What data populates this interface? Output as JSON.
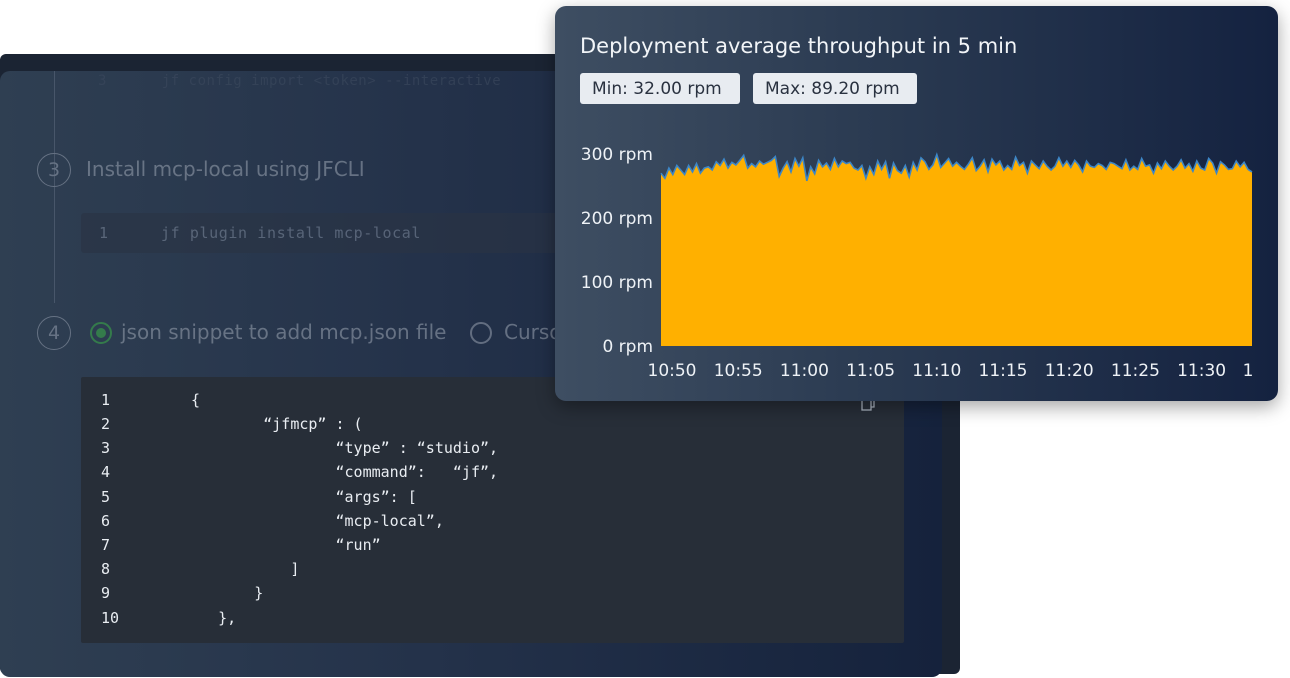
{
  "background_steps": {
    "faint_top_line": {
      "number": "3",
      "code": "jf config import <token> --interactive"
    },
    "step3": {
      "number": "3",
      "title": "Install mcp-local using JFCLI"
    },
    "step3_code": {
      "line_number": "1",
      "code": "jf plugin install mcp-local"
    },
    "step4": {
      "number": "4"
    },
    "options": [
      {
        "label": "json snippet to add mcp.json file",
        "selected": true
      },
      {
        "label": "Cursor",
        "selected": false
      }
    ],
    "code_block": {
      "lines": [
        {
          "n": "1",
          "text": "{"
        },
        {
          "n": "2",
          "text": "        “jfmcp” : ("
        },
        {
          "n": "3",
          "text": "                “type” : “studio”,"
        },
        {
          "n": "4",
          "text": "                “command”:   “jf”,"
        },
        {
          "n": "5",
          "text": "                “args”: ["
        },
        {
          "n": "6",
          "text": "                “mcp-local”,"
        },
        {
          "n": "7",
          "text": "                “run”"
        },
        {
          "n": "8",
          "text": "           ]"
        },
        {
          "n": "9",
          "text": "       }"
        },
        {
          "n": "10",
          "text": "   },"
        }
      ],
      "copy_icon": "copy-icon"
    }
  },
  "throughput_card": {
    "title": "Deployment average throughput in 5 min",
    "min_label": "Min: 32.00 rpm",
    "max_label": "Max: 89.20 rpm"
  },
  "chart_data": {
    "type": "area",
    "title": "Deployment average throughput in 5 min",
    "xlabel": "",
    "ylabel": "",
    "y_ticks": [
      "0 rpm",
      "100 rpm",
      "200 rpm",
      "300 rpm"
    ],
    "x_ticks": [
      "10:50",
      "10:55",
      "11:00",
      "11:05",
      "11:10",
      "11:15",
      "11:20",
      "11:25",
      "11:30",
      "1"
    ],
    "ylim": [
      0,
      300
    ],
    "grid": false,
    "fill_color": "#ffb000",
    "line_color": "#3d86c6",
    "series": [
      {
        "values": [
          270,
          262,
          278,
          268,
          282,
          275,
          268,
          282,
          272,
          285,
          270,
          278,
          280,
          275,
          288,
          282,
          292,
          278,
          287,
          283,
          290,
          298,
          278,
          285,
          280,
          289,
          284,
          287,
          290,
          296,
          265,
          278,
          288,
          272,
          293,
          281,
          294,
          258,
          280,
          269,
          290,
          280,
          286,
          276,
          293,
          280,
          289,
          285,
          287,
          278,
          275,
          282,
          262,
          280,
          268,
          289,
          276,
          288,
          262,
          286,
          274,
          270,
          282,
          264,
          287,
          275,
          294,
          288,
          276,
          283,
          299,
          279,
          286,
          293,
          281,
          287,
          281,
          276,
          284,
          294,
          274,
          281,
          291,
          272,
          292,
          283,
          289,
          275,
          282,
          276,
          295,
          282,
          287,
          270,
          289,
          283,
          277,
          289,
          281,
          275,
          281,
          294,
          281,
          289,
          279,
          290,
          283,
          272,
          289,
          281,
          279,
          285,
          282,
          276,
          287,
          285,
          281,
          277,
          291,
          275,
          281,
          276,
          293,
          281,
          283,
          270,
          286,
          277,
          289,
          281,
          275,
          281,
          291,
          278,
          285,
          273,
          289,
          278,
          275,
          293,
          286,
          270,
          288,
          283,
          276,
          277,
          289,
          280,
          287,
          276,
          272
        ]
      }
    ]
  }
}
